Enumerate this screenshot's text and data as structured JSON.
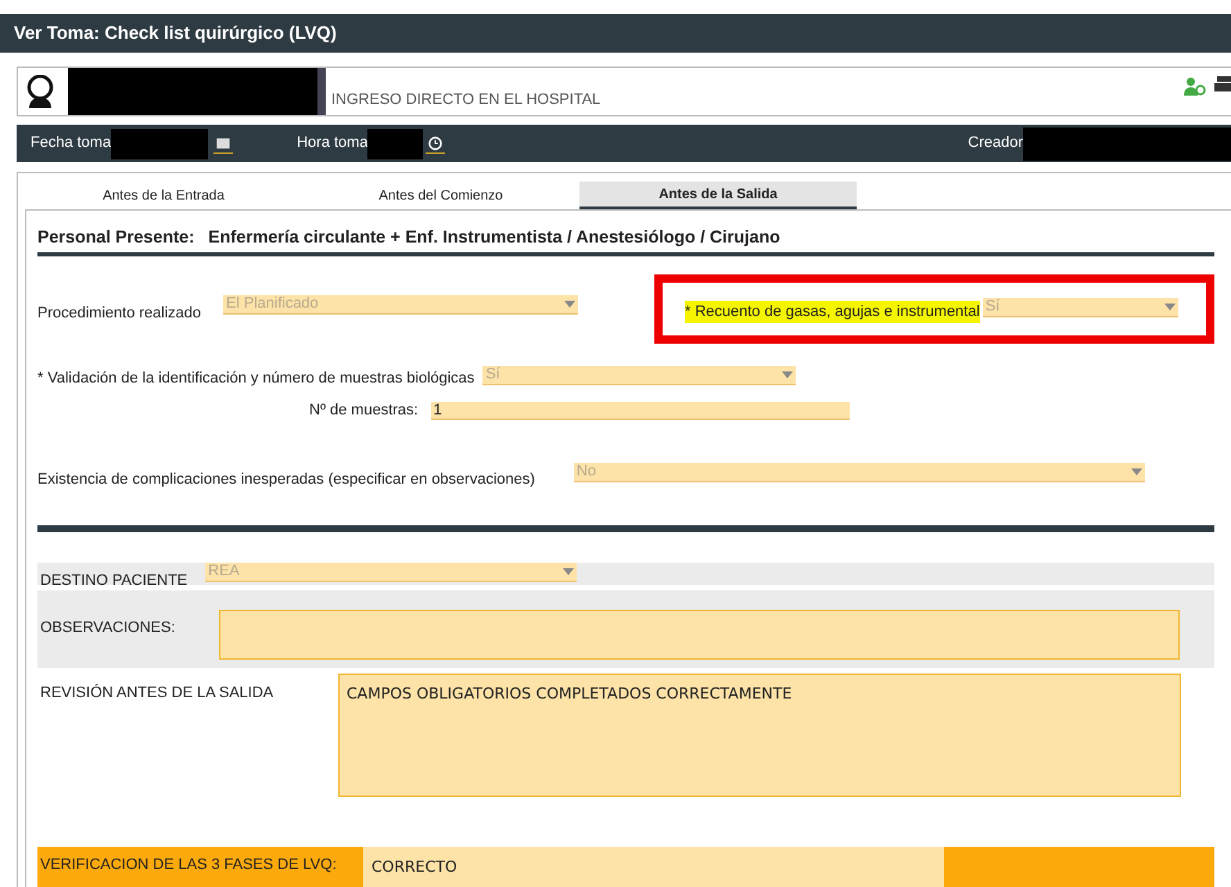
{
  "window": {
    "title": "Ver Toma: Check list quirúrgico (LVQ)"
  },
  "patient": {
    "admission": "INGRESO DIRECTO EN EL HOSPITAL"
  },
  "record_bar": {
    "date_label": "Fecha toma",
    "time_label": "Hora toma",
    "creator_label": "Creador"
  },
  "tabs": [
    {
      "label": "Antes de la Entrada",
      "selected": false
    },
    {
      "label": "Antes del Comienzo",
      "selected": false
    },
    {
      "label": "Antes de la Salida",
      "selected": true
    }
  ],
  "staff": {
    "label": "Personal Presente:",
    "value": "Enfermería circulante + Enf. Instrumentista / Anestesiólogo / Cirujano"
  },
  "procedure": {
    "label": "Procedimiento realizado",
    "value": "El Planificado",
    "disabled": true
  },
  "count": {
    "label": "* Recuento de gasas, agujas e instrumental",
    "value": "Sí",
    "disabled": true,
    "highlighted": true,
    "flagged": true
  },
  "validation": {
    "label": "* Validación de la identificación y número de muestras biológicas",
    "value": "Sí",
    "disabled": true
  },
  "samples": {
    "label": "Nº de muestras:",
    "value": "1"
  },
  "complications": {
    "label": "Existencia de complicaciones inesperadas (especificar en observaciones)",
    "value": "No",
    "disabled": true
  },
  "destination": {
    "label": "DESTINO PACIENTE",
    "value": "REA",
    "disabled": true
  },
  "observations": {
    "label": "OBSERVACIONES:"
  },
  "review": {
    "label": "REVISIÓN ANTES DE LA SALIDA",
    "value": "CAMPOS OBLIGATORIOS COMPLETADOS CORRECTAMENTE"
  },
  "verification": {
    "label": "VERIFICACION DE LAS 3 FASES DE LVQ:",
    "value": "CORRECTO"
  }
}
